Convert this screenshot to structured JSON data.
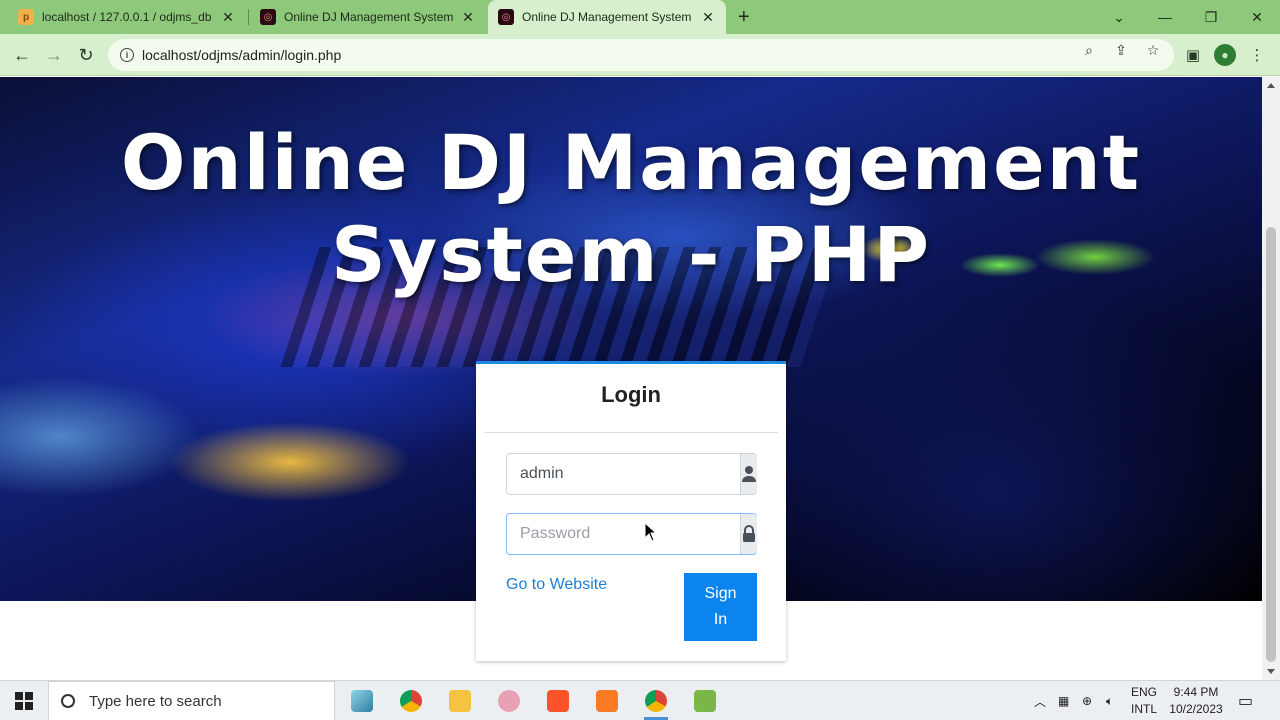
{
  "browser": {
    "tabs": [
      {
        "title": "localhost / 127.0.0.1 / odjms_db",
        "close": "✕",
        "favicon": "phpmyadmin-icon"
      },
      {
        "title": "Online DJ Management System",
        "close": "✕",
        "favicon": "site-favicon"
      },
      {
        "title": "Online DJ Management System",
        "close": "✕",
        "favicon": "site-favicon",
        "active": true
      }
    ],
    "new_tab": "+",
    "url": "localhost/odjms/admin/login.php"
  },
  "page": {
    "hero_title": "Online DJ Management System - PHP",
    "login": {
      "title": "Login",
      "username_value": "admin",
      "password_placeholder": "Password",
      "website_link": "Go to Website",
      "signin_label": "Sign In"
    }
  },
  "taskbar": {
    "search_placeholder": "Type here to search",
    "lang_line1": "ENG",
    "lang_line2": "INTL",
    "time": "9:44 PM",
    "date": "10/2/2023"
  },
  "colors": {
    "tab_strip": "#8dc87b",
    "toolbar": "#d7efcc",
    "accent": "#0b84ee",
    "link": "#1e7fd6"
  }
}
